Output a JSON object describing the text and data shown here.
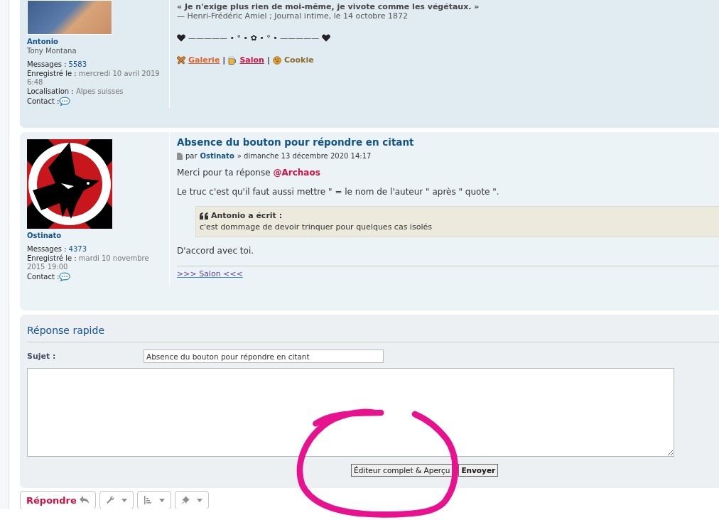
{
  "posts": [
    {
      "author": {
        "name": "Antonio",
        "rank": "Tony Montana",
        "stats": [
          {
            "label": "Messages :",
            "value": "5583",
            "kind": "link"
          },
          {
            "label": "Enregistré le :",
            "value": "mercredi 10 avril 2019 6:48",
            "kind": "text"
          },
          {
            "label": "Localisation :",
            "value": "Alpes suisses",
            "kind": "text"
          }
        ],
        "contact_label": "Contact :"
      },
      "body": [
        {
          "kind": "signature_quote",
          "text": "« Je n'exige plus rien de moi-même, je vivote comme les végétaux. »"
        },
        {
          "kind": "attribution",
          "text": "— Henri-Frédéric Amiel ; Journal intime, le 14 octobre 1872"
        },
        {
          "kind": "ornament",
          "text": "————— • ° • ✿ • ° • —————"
        },
        {
          "kind": "links",
          "items": [
            {
              "label": "Galerie",
              "color": "#e0622a",
              "underline": true
            },
            {
              "label": "Salon",
              "color": "#d31141",
              "underline": true
            },
            {
              "label": "Cookie",
              "color": "#8c6a2a",
              "underline": false
            }
          ],
          "separator": "|"
        }
      ]
    },
    {
      "author": {
        "name": "Ostinato",
        "stats": [
          {
            "label": "Messages :",
            "value": "4373",
            "kind": "link"
          },
          {
            "label": "Enregistré le :",
            "value": "mardi 10 novembre 2015 19:00",
            "kind": "text"
          }
        ],
        "contact_label": "Contact :"
      },
      "title": "Absence du bouton pour répondre en citant",
      "meta": {
        "by": "par",
        "author": "Ostinato",
        "date": "» dimanche 13 décembre 2020 14:17"
      },
      "body": [
        {
          "kind": "paragraph",
          "text": "Merci pour ta réponse",
          "mention": "@Archaos"
        },
        {
          "kind": "paragraph",
          "text": "Le truc c'est qu'il faut aussi mettre \" = le nom de l'auteur \" après \" quote \"."
        },
        {
          "kind": "quote",
          "cite": "Antonio a écrit :",
          "text": "c'est dommage de devoir trinquer pour quelques cas isolés"
        },
        {
          "kind": "paragraph",
          "text": "D'accord avec toi."
        }
      ],
      "signature_link": ">>> Salon <<<"
    }
  ],
  "quick_reply": {
    "title": "Réponse rapide",
    "subject_label": "Sujet :",
    "subject_value": "Absence du bouton pour répondre en citant",
    "buttons": [
      "Éditeur complet & Aperçu",
      "Envoyer"
    ]
  },
  "toolbar": {
    "reply_label": "Répondre",
    "tools": [
      {
        "kind": "wrench"
      },
      {
        "kind": "list"
      },
      {
        "kind": "pin"
      }
    ]
  }
}
